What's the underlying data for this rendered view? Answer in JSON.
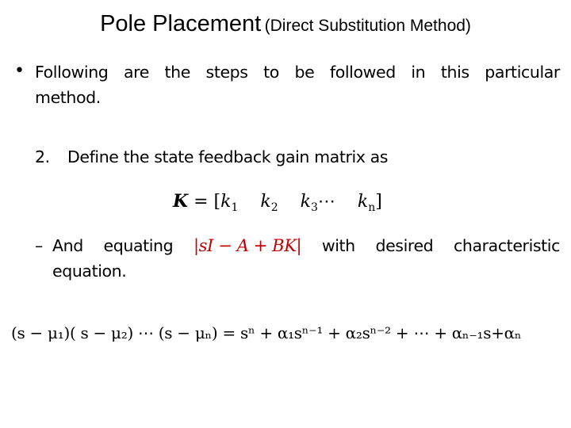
{
  "slide": {
    "title_main": "Pole Placement",
    "title_sub": "(Direct Substitution Method)",
    "bullet_symbol": "•",
    "intro_line1_words": [
      "Following",
      "are",
      "the",
      "steps",
      "to",
      "be",
      "followed",
      "in",
      "this",
      "particular"
    ],
    "intro_line2": "method.",
    "step_number": "2.",
    "step_text": "Define the state feedback gain matrix as",
    "k_matrix": {
      "lhs": "K",
      "equals": " = [",
      "elements": [
        {
          "var": "k",
          "sub": "1"
        },
        {
          "var": "k",
          "sub": "2"
        },
        {
          "var": "k",
          "sub": "3"
        },
        {
          "var": "k",
          "sub": "n"
        }
      ],
      "ellipsis": "⋯",
      "close": "]"
    },
    "dash_symbol": "–",
    "equating_words_before": [
      "And",
      "equating"
    ],
    "highlight_expression": "|sI − A + BK|",
    "equating_words_after": [
      "with",
      "desired",
      "characteristic"
    ],
    "equating_line2": "equation.",
    "characteristic_equation": {
      "lhs": "(s − μ₁)( s − μ₂) ⋯ (s − μₙ)",
      "rhs": "sⁿ + α₁sⁿ⁻¹ + α₂sⁿ⁻² + ⋯ + αₙ₋₁s+αₙ"
    },
    "colors": {
      "highlight": "#c00000",
      "text": "#000000",
      "background": "#ffffff"
    }
  }
}
